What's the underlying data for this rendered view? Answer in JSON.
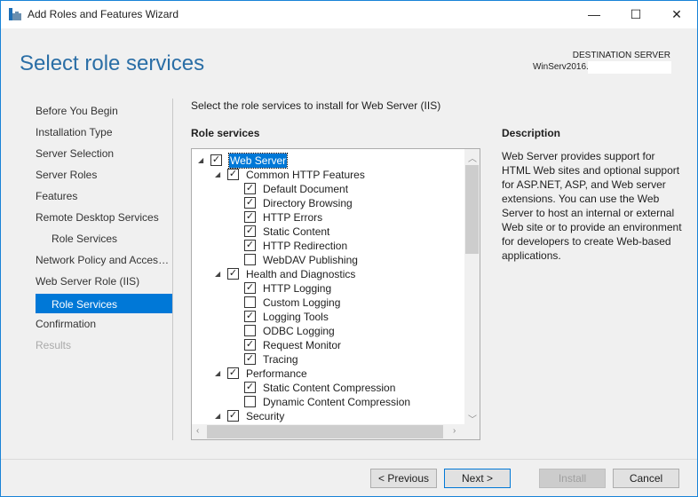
{
  "window": {
    "title": "Add Roles and Features Wizard",
    "minimize": "—",
    "maximize": "☐",
    "close": "✕"
  },
  "header": {
    "title": "Select role services",
    "destination_label": "DESTINATION SERVER",
    "destination_value": "WinServ2016."
  },
  "nav": {
    "items": [
      {
        "label": "Before You Begin",
        "state": "normal",
        "sub": false
      },
      {
        "label": "Installation Type",
        "state": "normal",
        "sub": false
      },
      {
        "label": "Server Selection",
        "state": "normal",
        "sub": false
      },
      {
        "label": "Server Roles",
        "state": "normal",
        "sub": false
      },
      {
        "label": "Features",
        "state": "normal",
        "sub": false
      },
      {
        "label": "Remote Desktop Services",
        "state": "normal",
        "sub": false
      },
      {
        "label": "Role Services",
        "state": "normal",
        "sub": true
      },
      {
        "label": "Network Policy and Access Services",
        "state": "normal",
        "sub": false
      },
      {
        "label": "Web Server Role (IIS)",
        "state": "normal",
        "sub": false
      },
      {
        "label": "Role Services",
        "state": "selected",
        "sub": true
      },
      {
        "label": "Confirmation",
        "state": "normal",
        "sub": false
      },
      {
        "label": "Results",
        "state": "disabled",
        "sub": false
      }
    ]
  },
  "main": {
    "instruction": "Select the role services to install for Web Server (IIS)",
    "role_services_heading": "Role services",
    "tree": [
      {
        "label": "Web Server",
        "level": 0,
        "checked": true,
        "expandable": true,
        "selected": true
      },
      {
        "label": "Common HTTP Features",
        "level": 1,
        "checked": true,
        "expandable": true
      },
      {
        "label": "Default Document",
        "level": 2,
        "checked": true
      },
      {
        "label": "Directory Browsing",
        "level": 2,
        "checked": true
      },
      {
        "label": "HTTP Errors",
        "level": 2,
        "checked": true
      },
      {
        "label": "Static Content",
        "level": 2,
        "checked": true
      },
      {
        "label": "HTTP Redirection",
        "level": 2,
        "checked": true
      },
      {
        "label": "WebDAV Publishing",
        "level": 2,
        "checked": false
      },
      {
        "label": "Health and Diagnostics",
        "level": 1,
        "checked": true,
        "expandable": true
      },
      {
        "label": "HTTP Logging",
        "level": 2,
        "checked": true
      },
      {
        "label": "Custom Logging",
        "level": 2,
        "checked": false
      },
      {
        "label": "Logging Tools",
        "level": 2,
        "checked": true
      },
      {
        "label": "ODBC Logging",
        "level": 2,
        "checked": false
      },
      {
        "label": "Request Monitor",
        "level": 2,
        "checked": true
      },
      {
        "label": "Tracing",
        "level": 2,
        "checked": true
      },
      {
        "label": "Performance",
        "level": 1,
        "checked": true,
        "expandable": true
      },
      {
        "label": "Static Content Compression",
        "level": 2,
        "checked": true
      },
      {
        "label": "Dynamic Content Compression",
        "level": 2,
        "checked": false
      },
      {
        "label": "Security",
        "level": 1,
        "checked": true,
        "expandable": true
      }
    ],
    "description_heading": "Description",
    "description": "Web Server provides support for HTML Web sites and optional support for ASP.NET, ASP, and Web server extensions. You can use the Web Server to host an internal or external Web site or to provide an environment for developers to create Web-based applications."
  },
  "footer": {
    "previous": "< Previous",
    "next": "Next >",
    "install": "Install",
    "cancel": "Cancel"
  },
  "colors": {
    "accent": "#0078d7",
    "heading": "#2a6ea6"
  }
}
